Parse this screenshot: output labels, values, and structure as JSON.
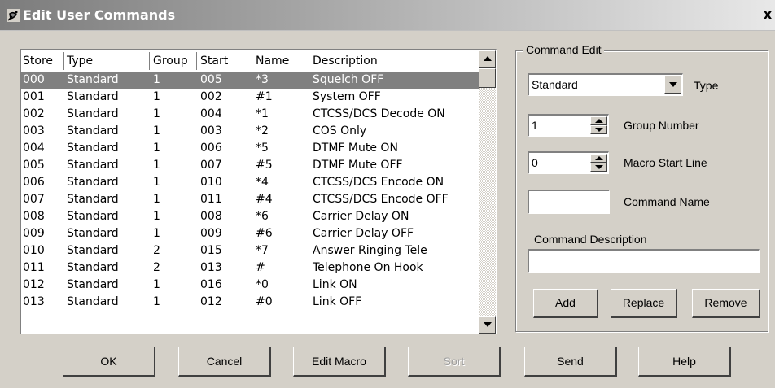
{
  "window": {
    "title": "Edit User Commands",
    "close_label": "x"
  },
  "list": {
    "headers": {
      "store": "Store",
      "type": "Type",
      "group": "Group",
      "start": "Start",
      "name": "Name",
      "description": "Description"
    },
    "rows": [
      {
        "store": "000",
        "type": "Standard",
        "group": "1",
        "start": "005",
        "name": "*3",
        "description": "Squelch OFF"
      },
      {
        "store": "001",
        "type": "Standard",
        "group": "1",
        "start": "002",
        "name": "#1",
        "description": "System OFF"
      },
      {
        "store": "002",
        "type": "Standard",
        "group": "1",
        "start": "004",
        "name": "*1",
        "description": "CTCSS/DCS Decode ON"
      },
      {
        "store": "003",
        "type": "Standard",
        "group": "1",
        "start": "003",
        "name": "*2",
        "description": "COS Only"
      },
      {
        "store": "004",
        "type": "Standard",
        "group": "1",
        "start": "006",
        "name": "*5",
        "description": "DTMF Mute ON"
      },
      {
        "store": "005",
        "type": "Standard",
        "group": "1",
        "start": "007",
        "name": "#5",
        "description": "DTMF Mute OFF"
      },
      {
        "store": "006",
        "type": "Standard",
        "group": "1",
        "start": "010",
        "name": "*4",
        "description": "CTCSS/DCS Encode ON"
      },
      {
        "store": "007",
        "type": "Standard",
        "group": "1",
        "start": "011",
        "name": "#4",
        "description": "CTCSS/DCS Encode OFF"
      },
      {
        "store": "008",
        "type": "Standard",
        "group": "1",
        "start": "008",
        "name": "*6",
        "description": "Carrier Delay ON"
      },
      {
        "store": "009",
        "type": "Standard",
        "group": "1",
        "start": "009",
        "name": "#6",
        "description": "Carrier Delay OFF"
      },
      {
        "store": "010",
        "type": "Standard",
        "group": "2",
        "start": "015",
        "name": "*7",
        "description": "Answer Ringing Tele"
      },
      {
        "store": "011",
        "type": "Standard",
        "group": "2",
        "start": "013",
        "name": "#",
        "description": "Telephone On Hook"
      },
      {
        "store": "012",
        "type": "Standard",
        "group": "1",
        "start": "016",
        "name": "*0",
        "description": "Link ON"
      },
      {
        "store": "013",
        "type": "Standard",
        "group": "1",
        "start": "012",
        "name": "#0",
        "description": "Link OFF"
      }
    ]
  },
  "command_edit": {
    "group_label": "Command Edit",
    "type_value": "Standard",
    "type_label": "Type",
    "group_number_value": "1",
    "group_number_label": "Group Number",
    "macro_start_value": "0",
    "macro_start_label": "Macro Start Line",
    "command_name_value": "",
    "command_name_label": "Command Name",
    "description_label": "Command Description",
    "description_value": "",
    "add_label": "Add",
    "replace_label": "Replace",
    "remove_label": "Remove"
  },
  "footer": {
    "ok_label": "OK",
    "cancel_label": "Cancel",
    "edit_macro_label": "Edit Macro",
    "sort_label": "Sort",
    "send_label": "Send",
    "help_label": "Help"
  }
}
